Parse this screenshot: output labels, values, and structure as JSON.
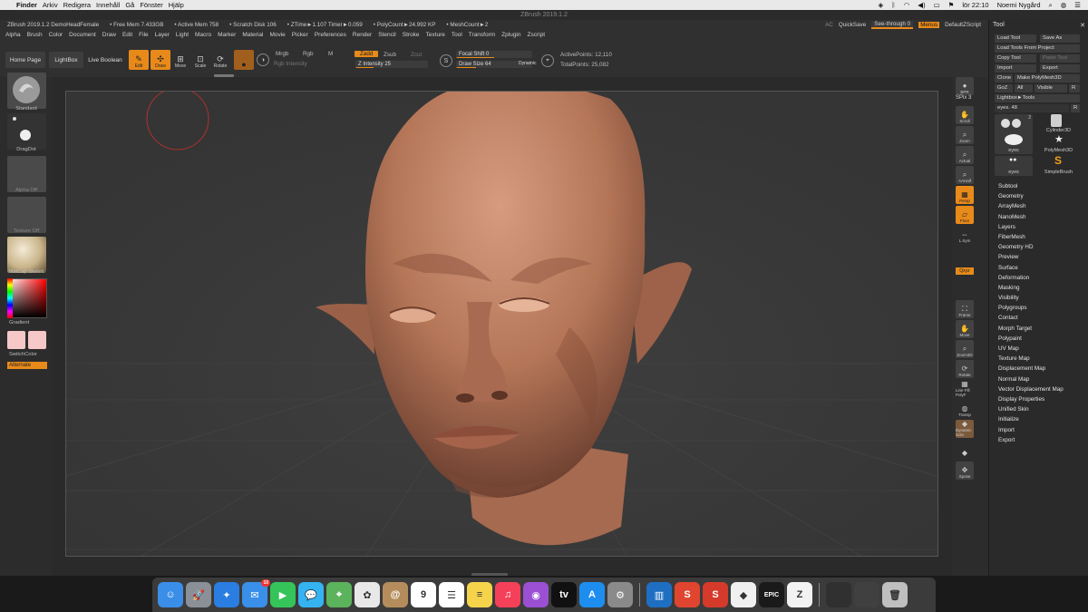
{
  "mac_menubar": {
    "app": "Finder",
    "items": [
      "Arkiv",
      "Redigera",
      "Innehåll",
      "Gå",
      "Fönster",
      "Hjälp"
    ],
    "clock": "lör 22:10",
    "user": "Noemi Nygård"
  },
  "window_title": "ZBrush 2019.1.2",
  "status": {
    "doc": "ZBrush 2019.1.2 DemoHeadFemale",
    "free_mem": "• Free Mem 7.433GB",
    "active_mem": "• Active Mem 758",
    "scratch": "• Scratch Disk 106",
    "ztime": "• ZTime►1.107 Timer►0.059",
    "polycount": "• PolyCount►24.992 KP",
    "meshcount": "• MeshCount►2",
    "ac": "AC",
    "quicksave": "QuickSave",
    "see_through": "See-through  0",
    "menus": "Menus",
    "script": "DefaultZScript"
  },
  "menu": [
    "Alpha",
    "Brush",
    "Color",
    "Document",
    "Draw",
    "Edit",
    "File",
    "Layer",
    "Light",
    "Macro",
    "Marker",
    "Material",
    "Movie",
    "Picker",
    "Preferences",
    "Render",
    "Stencil",
    "Stroke",
    "Texture",
    "Tool",
    "Transform",
    "Zplugin",
    "Zscript"
  ],
  "shelf": {
    "home_page": "Home Page",
    "lightbox": "LightBox",
    "live_boolean": "Live Boolean",
    "tools": [
      "Edit",
      "Draw",
      "Move",
      "Scale",
      "Rotate"
    ],
    "mrgb": "Mrgb",
    "rgb": "Rgb",
    "m": "M",
    "rgb_intensity": "Rgb Intensity",
    "zadd": "Zadd",
    "zsub": "Zsub",
    "zcut": "Zcut",
    "z_intensity": "Z Intensity 25",
    "focal_shift": "Focal Shift  0",
    "draw_size": "Draw Size  64",
    "dynamic": "Dynamic",
    "active_points": "ActivePoints: 12,110",
    "total_points": "TotalPoints: 25,082"
  },
  "left_tray": {
    "brush": "Standard",
    "stroke": "DragDot",
    "alpha": "Alpha Off",
    "texture": "Texture Off",
    "material": "MatCap Skeleti",
    "gradient": "Gradient",
    "switch_color": "SwitchColor",
    "alternate": "Alternate"
  },
  "right_shelf": [
    {
      "label": "BPR",
      "icon": "sphere-icon",
      "active": false
    },
    {
      "label": "SPix 3",
      "icon": "",
      "active": false
    },
    {
      "label": "Scroll",
      "icon": "hand-icon",
      "active": false
    },
    {
      "label": "Zoom",
      "icon": "magnifier-icon",
      "active": false
    },
    {
      "label": "Actual",
      "icon": "actual-icon",
      "active": false
    },
    {
      "label": "AAHalf",
      "icon": "aahalf-icon",
      "active": false
    },
    {
      "label": "Persp",
      "icon": "persp-icon",
      "active": true
    },
    {
      "label": "Floor",
      "icon": "floor-icon",
      "active": true
    },
    {
      "label": "L.Sym",
      "icon": "lsym-icon",
      "active": false
    },
    {
      "label": "Qxyz",
      "icon": "",
      "active": true
    },
    {
      "label": "Frame",
      "icon": "frame-icon",
      "active": false
    },
    {
      "label": "Move",
      "icon": "move-icon",
      "active": false
    },
    {
      "label": "Zoom3D",
      "icon": "zoom3d-icon",
      "active": false
    },
    {
      "label": "Rotate",
      "icon": "rotate-icon",
      "active": false
    },
    {
      "label": "Line Fill PolyF",
      "icon": "polyf-icon",
      "active": false
    },
    {
      "label": "Transp",
      "icon": "transp-icon",
      "active": false
    },
    {
      "label": "Dynamic Solo",
      "icon": "solo-icon",
      "active": false
    },
    {
      "label": "Xpose",
      "icon": "xpose-icon",
      "active": false
    }
  ],
  "tool_panel": {
    "title": "Tool",
    "load_tool": "Load Tool",
    "save_as": "Save As",
    "load_from_project": "Load Tools From Project",
    "copy_tool": "Copy Tool",
    "paste_tool": "Paste Tool",
    "import": "Import",
    "export": "Export",
    "clone": "Clone",
    "make_polymesh": "Make PolyMesh3D",
    "goz": "GoZ",
    "all": "All",
    "visible": "Visible",
    "r": "R",
    "lightbox_tools": "Lightbox►Tools",
    "eyes_slider": "eyes. 48",
    "thumbs": [
      "eyes",
      "Cylinder3D",
      "PolyMesh3D",
      "eyes",
      "SimpleBrush"
    ],
    "thumb_count": "2",
    "subpalettes": [
      "Subtool",
      "Geometry",
      "ArrayMesh",
      "NanoMesh",
      "Layers",
      "FiberMesh",
      "Geometry HD",
      "Preview",
      "Surface",
      "Deformation",
      "Masking",
      "Visibility",
      "Polygroups",
      "Contact",
      "Morph Target",
      "Polypaint",
      "UV Map",
      "Texture Map",
      "Displacement Map",
      "Normal Map",
      "Vector Displacement Map",
      "Display Properties",
      "Unified Skin",
      "Initialize",
      "Import",
      "Export"
    ]
  },
  "dock": {
    "apps": [
      {
        "name": "Finder",
        "glyph": "☺",
        "color": "#3b8ee8"
      },
      {
        "name": "Launchpad",
        "glyph": "🚀",
        "color": "#8a8f98"
      },
      {
        "name": "Safari",
        "glyph": "✦",
        "color": "#2a7de1"
      },
      {
        "name": "Mail",
        "glyph": "✉",
        "color": "#3a8fe8",
        "badge": "10"
      },
      {
        "name": "FaceTime",
        "glyph": "▶",
        "color": "#35c45a"
      },
      {
        "name": "Messages",
        "glyph": "💬",
        "color": "#35b3f0"
      },
      {
        "name": "Maps",
        "glyph": "⌖",
        "color": "#5bb35b"
      },
      {
        "name": "Photos",
        "glyph": "✿",
        "color": "#e8e8e8"
      },
      {
        "name": "Contacts",
        "glyph": "@",
        "color": "#b58d5c"
      },
      {
        "name": "Calendar",
        "glyph": "9",
        "color": "#ffffff"
      },
      {
        "name": "Reminders",
        "glyph": "☰",
        "color": "#ffffff"
      },
      {
        "name": "Notes",
        "glyph": "≡",
        "color": "#f5d44b"
      },
      {
        "name": "Music",
        "glyph": "♫",
        "color": "#f5405a"
      },
      {
        "name": "Podcasts",
        "glyph": "◉",
        "color": "#9b4fd3"
      },
      {
        "name": "TV",
        "glyph": "tv",
        "color": "#111111"
      },
      {
        "name": "App Store",
        "glyph": "A",
        "color": "#1d8ef0"
      },
      {
        "name": "System Preferences",
        "glyph": "⚙",
        "color": "#8a8a8a"
      },
      {
        "name": "Trello",
        "glyph": "▥",
        "color": "#1e6fc2"
      },
      {
        "name": "Substance",
        "glyph": "S",
        "color": "#e0452f"
      },
      {
        "name": "Substance Painter",
        "glyph": "S",
        "color": "#d63a2a"
      },
      {
        "name": "Affinity",
        "glyph": "◆",
        "color": "#f0f0f0"
      },
      {
        "name": "Epic Games",
        "glyph": "EPIC",
        "color": "#1a1a1a"
      },
      {
        "name": "ZBrush",
        "glyph": "Z",
        "color": "#f2f2f2"
      },
      {
        "name": "Window 1",
        "glyph": "",
        "color": "#303030"
      },
      {
        "name": "Window 2",
        "glyph": "",
        "color": "#404040"
      },
      {
        "name": "Trash",
        "glyph": "🗑",
        "color": "#bfbfbf"
      }
    ]
  }
}
